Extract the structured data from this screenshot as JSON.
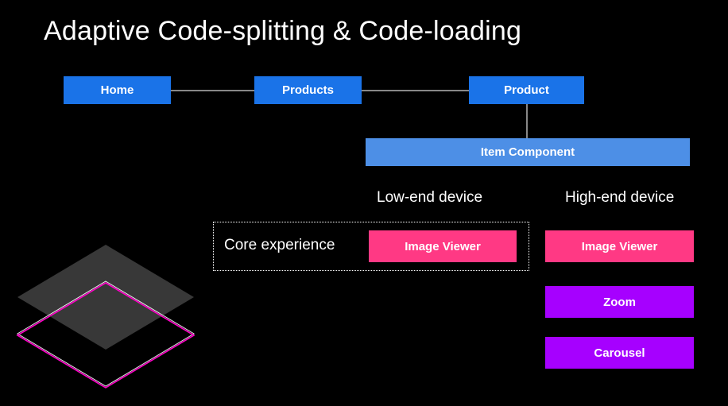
{
  "title": "Adaptive Code-splitting & Code-loading",
  "nav": {
    "home": "Home",
    "products": "Products",
    "product": "Product"
  },
  "item_component": "Item Component",
  "headers": {
    "low": "Low-end device",
    "high": "High-end device"
  },
  "core_label": "Core experience",
  "low": {
    "viewer": "Image Viewer"
  },
  "high": {
    "viewer": "Image Viewer",
    "zoom": "Zoom",
    "carousel": "Carousel"
  }
}
